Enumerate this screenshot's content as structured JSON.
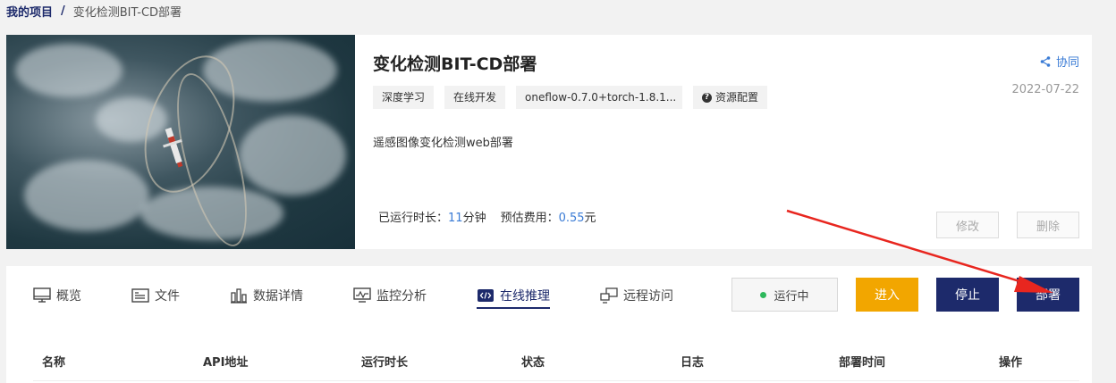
{
  "breadcrumb": {
    "root": "我的项目",
    "sep": "/",
    "current": "变化检测BIT-CD部署"
  },
  "project": {
    "title": "变化检测BIT-CD部署",
    "tags": [
      "深度学习",
      "在线开发",
      "oneflow-0.7.0+torch-1.8.1..."
    ],
    "resource_label": "资源配置",
    "description": "遥感图像变化检测web部署",
    "runtime_label": "已运行时长：",
    "runtime_value": "11",
    "runtime_unit": "分钟",
    "cost_label": "预估费用：",
    "cost_value": "0.55",
    "cost_unit": "元",
    "collab_label": "协同",
    "date": "2022-07-22",
    "edit_label": "修改",
    "delete_label": "删除"
  },
  "tabs": [
    {
      "label": "概览",
      "icon": "monitor-icon"
    },
    {
      "label": "文件",
      "icon": "file-icon"
    },
    {
      "label": "数据详情",
      "icon": "bar-chart-icon"
    },
    {
      "label": "监控分析",
      "icon": "monitor-wave-icon"
    },
    {
      "label": "在线推理",
      "icon": "code-icon",
      "active": true
    },
    {
      "label": "远程访问",
      "icon": "remote-icon"
    }
  ],
  "actions": {
    "status": "运行中",
    "enter": "进入",
    "stop": "停止",
    "deploy": "部署"
  },
  "table": {
    "columns": [
      "名称",
      "API地址",
      "运行时长",
      "状态",
      "日志",
      "部署时间",
      "操作"
    ]
  },
  "colors": {
    "primary": "#1d2a6b",
    "accent_orange": "#f2a600",
    "link_blue": "#3a7bd5",
    "status_green": "#2eb85c",
    "annotation_red": "#e8261f"
  }
}
